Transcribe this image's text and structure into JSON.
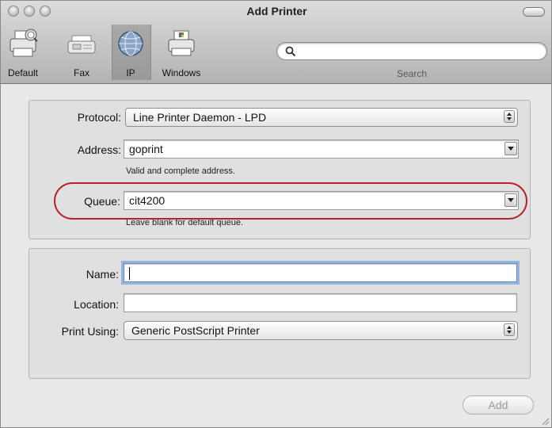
{
  "window": {
    "title": "Add Printer"
  },
  "toolbar": {
    "items": [
      {
        "label": "Default",
        "icon": "printer-icon"
      },
      {
        "label": "Fax",
        "icon": "fax-icon"
      },
      {
        "label": "IP",
        "icon": "globe-icon",
        "selected": true
      },
      {
        "label": "Windows",
        "icon": "windows-printer-icon"
      }
    ],
    "search": {
      "label": "Search",
      "value": ""
    }
  },
  "connection": {
    "protocol_label": "Protocol:",
    "protocol_value": "Line Printer Daemon - LPD",
    "address_label": "Address:",
    "address_value": "goprint",
    "address_note": "Valid and complete address.",
    "queue_label": "Queue:",
    "queue_value": "cit4200",
    "queue_note": "Leave blank for default queue."
  },
  "details": {
    "name_label": "Name:",
    "name_value": "",
    "location_label": "Location:",
    "location_value": "",
    "print_using_label": "Print Using:",
    "print_using_value": "Generic PostScript Printer"
  },
  "footer": {
    "add_label": "Add",
    "add_enabled": false
  },
  "colors": {
    "highlight_circle": "#b8232a",
    "focus_ring": "#94b4e0"
  }
}
